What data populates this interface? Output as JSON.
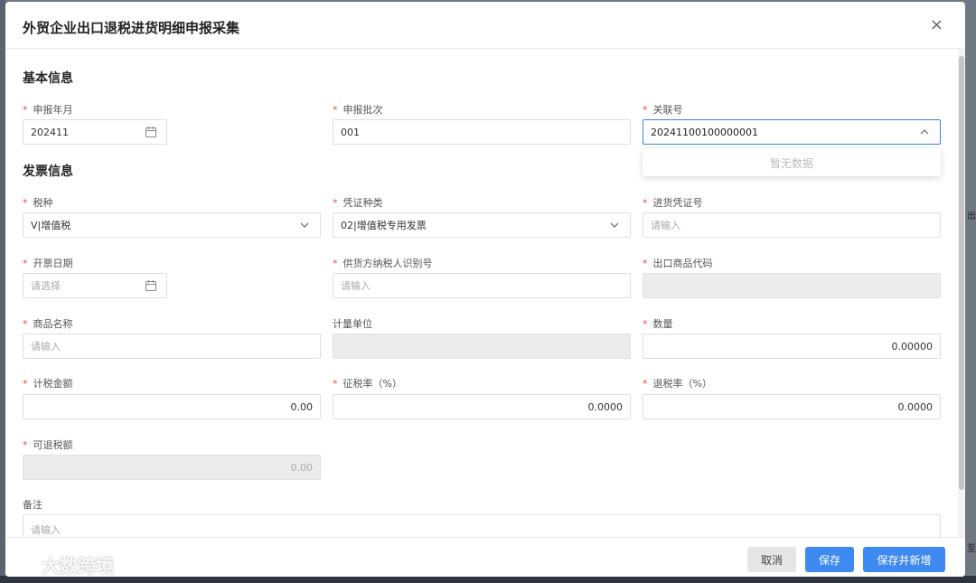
{
  "dialog": {
    "title": "外贸企业出口退税进货明细申报采集",
    "close_symbol": "×"
  },
  "sections": {
    "basic": "基本信息",
    "invoice": "发票信息"
  },
  "fields": {
    "report_month": {
      "label": "申报年月",
      "value": "202411"
    },
    "report_batch": {
      "label": "申报批次",
      "value": "001"
    },
    "link_no": {
      "label": "关联号",
      "value": "20241100100000001"
    },
    "tax_type": {
      "label": "税种",
      "value": "V|增值税"
    },
    "voucher_type": {
      "label": "凭证种类",
      "value": "02|增值税专用发票"
    },
    "purchase_voucher_no": {
      "label": "进货凭证号",
      "placeholder": "请输入"
    },
    "invoice_date": {
      "label": "开票日期",
      "placeholder": "请选择"
    },
    "supplier_tax_id": {
      "label": "供货方纳税人识别号",
      "placeholder": "请输入"
    },
    "export_goods_code": {
      "label": "出口商品代码"
    },
    "goods_name": {
      "label": "商品名称",
      "placeholder": "请输入"
    },
    "unit": {
      "label": "计量单位"
    },
    "quantity": {
      "label": "数量",
      "value": "0.00000"
    },
    "taxable_amount": {
      "label": "计税金额",
      "value": "0.00"
    },
    "levy_rate": {
      "label": "征税率（%）",
      "value": "0.0000"
    },
    "refund_rate": {
      "label": "退税率（%）",
      "value": "0.0000"
    },
    "refundable_amount": {
      "label": "可退税额",
      "value": "0.00"
    },
    "remark": {
      "label": "备注",
      "placeholder": "请输入"
    }
  },
  "required_mark": "*",
  "dropdown": {
    "empty_text": "暂无数据"
  },
  "footer": {
    "cancel": "取消",
    "save": "保存",
    "save_and_new": "保存并新增"
  },
  "watermark": {
    "text": "大数跨境"
  },
  "background": {
    "right_text": "出",
    "right_text2": "至"
  },
  "colors": {
    "primary": "#3e8af0",
    "required": "#e84a4a",
    "disabled_bg": "#ececec"
  }
}
